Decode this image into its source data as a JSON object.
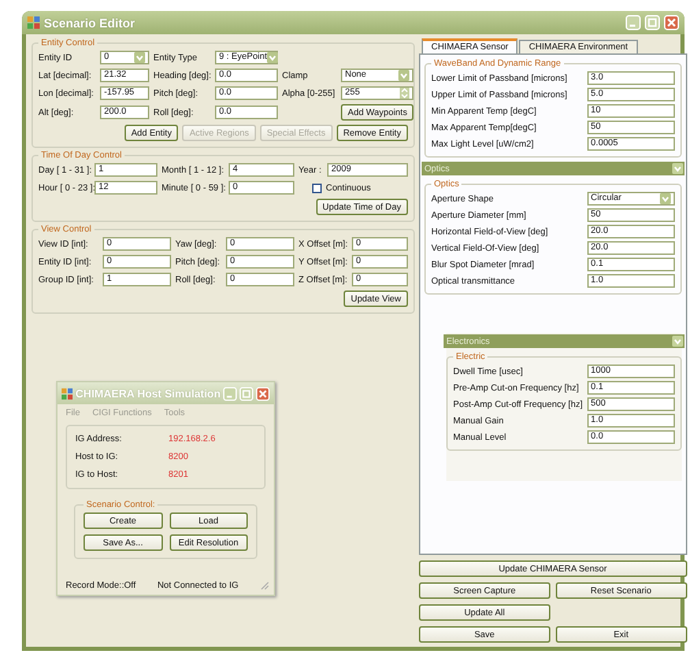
{
  "window": {
    "title": "Scenario Editor"
  },
  "entity_control": {
    "title": "Entity Control",
    "rows": [
      [
        {
          "label": "Entity ID",
          "kind": "dropdown",
          "value": "0"
        },
        {
          "label": "Entity Type",
          "kind": "dropdown",
          "value": "9 : EyePoint"
        }
      ],
      [
        {
          "label": "Lat [decimal]:",
          "kind": "text",
          "value": "21.32"
        },
        {
          "label": "Heading [deg]:",
          "kind": "text",
          "value": "0.0"
        },
        {
          "label": "Clamp",
          "kind": "dropdown",
          "value": "None"
        }
      ],
      [
        {
          "label": "Lon [decimal]:",
          "kind": "text",
          "value": "-157.95"
        },
        {
          "label": "Pitch [deg]:",
          "kind": "text",
          "value": "0.0"
        },
        {
          "label": "Alpha [0-255]",
          "kind": "spinner",
          "value": "255"
        }
      ],
      [
        {
          "label": "Alt [deg]:",
          "kind": "text",
          "value": "200.0"
        },
        {
          "label": "Roll [deg]:",
          "kind": "text",
          "value": "0.0"
        },
        {
          "kind": "button",
          "text": "Add Waypoints"
        }
      ]
    ],
    "buttons": [
      {
        "label": "Add Entity",
        "disabled": false
      },
      {
        "label": "Active Regions",
        "disabled": true
      },
      {
        "label": "Special Effects",
        "disabled": true
      },
      {
        "label": "Remove Entity",
        "disabled": false
      }
    ]
  },
  "time_of_day": {
    "title": "Time Of Day Control",
    "rows": [
      [
        {
          "label": "Day [ 1 - 31 ]:",
          "kind": "text",
          "value": "1"
        },
        {
          "label": "Month [ 1 - 12 ]:",
          "kind": "text",
          "value": "4"
        },
        {
          "label": "Year :",
          "kind": "text",
          "value": "2009"
        }
      ],
      [
        {
          "label": "Hour [ 0 - 23 ]:",
          "kind": "text",
          "value": "12"
        },
        {
          "label": "Minute [ 0 - 59 ]:",
          "kind": "text",
          "value": "0"
        },
        {
          "kind": "checkbox",
          "text": "Continuous",
          "checked": false
        }
      ]
    ],
    "buttons": [
      {
        "label": "Update Time of Day",
        "disabled": false
      }
    ]
  },
  "view_control": {
    "title": "View Control",
    "rows": [
      [
        {
          "label": "View ID [int]:",
          "kind": "text",
          "value": "0"
        },
        {
          "label": "Yaw [deg]:",
          "kind": "text",
          "value": "0"
        },
        {
          "label": "X Offset [m]:",
          "kind": "text",
          "value": "0"
        }
      ],
      [
        {
          "label": "Entity ID [int]:",
          "kind": "text",
          "value": "0"
        },
        {
          "label": "Pitch [deg]:",
          "kind": "text",
          "value": "0"
        },
        {
          "label": "Y Offset [m]:",
          "kind": "text",
          "value": "0"
        }
      ],
      [
        {
          "label": "Group ID [int]:",
          "kind": "text",
          "value": "1"
        },
        {
          "label": "Roll [deg]:",
          "kind": "text",
          "value": "0"
        },
        {
          "label": "Z Offset [m]:",
          "kind": "text",
          "value": "0"
        }
      ]
    ],
    "buttons": [
      {
        "label": "Update View",
        "disabled": false
      }
    ]
  },
  "host_simulation": {
    "title": "CHIMAERA Host Simulation",
    "menu": [
      "File",
      "CIGI Functions",
      "Tools"
    ],
    "info": [
      {
        "label": "IG Address:",
        "value": "192.168.2.6"
      },
      {
        "label": "Host to IG:",
        "value": "8200"
      },
      {
        "label": "IG to Host:",
        "value": "8201"
      }
    ],
    "scenario_control": {
      "title": "Scenario Control:",
      "buttons": [
        "Create",
        "Load",
        "Save As...",
        "Edit Resolution"
      ]
    },
    "status": [
      "Record Mode::Off",
      "Not Connected to IG"
    ]
  },
  "tabs": [
    {
      "label": "CHIMAERA Sensor",
      "selected": true
    },
    {
      "label": "CHIMAERA Environment",
      "selected": false
    }
  ],
  "sensor_sections": [
    {
      "kind": "group",
      "title": "WaveBand And Dynamic Range",
      "fields": [
        {
          "label": "Lower Limit of Passband [microns]",
          "kind": "text",
          "value": "3.0"
        },
        {
          "label": "Upper Limit of Passband [microns]",
          "kind": "text",
          "value": "5.0"
        },
        {
          "label": "Min Apparent Temp [degC]",
          "kind": "text",
          "value": "10"
        },
        {
          "label": "Max Apparent Temp[degC]",
          "kind": "text",
          "value": "50"
        },
        {
          "label": "Max Light Level [uW/cm2]",
          "kind": "text",
          "value": "0.0005"
        }
      ]
    },
    {
      "kind": "header",
      "title": "Optics"
    },
    {
      "kind": "group",
      "title": "Optics",
      "fields": [
        {
          "label": "Aperture Shape",
          "kind": "dropdown",
          "value": "Circular"
        },
        {
          "label": "Aperture Diameter [mm]",
          "kind": "text",
          "value": "50"
        },
        {
          "label": "Horizontal Field-of-View [deg]",
          "kind": "text",
          "value": "20.0"
        },
        {
          "label": "Vertical Field-Of-View [deg]",
          "kind": "text",
          "value": "20.0"
        },
        {
          "label": "Blur Spot Diameter [mrad]",
          "kind": "text",
          "value": "0.1"
        },
        {
          "label": "Optical transmittance",
          "kind": "text",
          "value": "1.0"
        }
      ]
    },
    {
      "kind": "header",
      "title": "Electronics"
    },
    {
      "kind": "group",
      "title": "Electric",
      "fields": [
        {
          "label": "Dwell Time [usec]",
          "kind": "text",
          "value": "1000"
        },
        {
          "label": "Pre-Amp Cut-on Frequency [hz]",
          "kind": "text",
          "value": "0.1"
        },
        {
          "label": "Post-Amp Cut-off Frequency [hz]",
          "kind": "text",
          "value": "500"
        },
        {
          "label": "Manual Gain",
          "kind": "text",
          "value": "1.0"
        },
        {
          "label": "Manual Level",
          "kind": "text",
          "value": "0.0"
        }
      ]
    }
  ],
  "bottom_buttons": [
    {
      "label": "Update CHIMAERA Sensor"
    },
    {
      "label": "Screen Capture"
    },
    {
      "label": "Reset Scenario"
    },
    {
      "label": "Update All"
    },
    {
      "label": "Save"
    },
    {
      "label": "Exit"
    }
  ]
}
